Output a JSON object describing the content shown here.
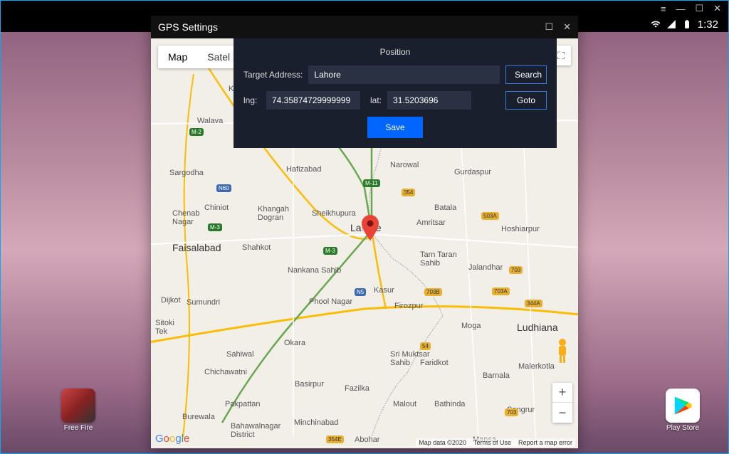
{
  "titlebar": {
    "menu": "≡",
    "min": "—",
    "max": "☐",
    "close": "✕"
  },
  "statusbar": {
    "time": "1:32"
  },
  "gps": {
    "title": "GPS Settings",
    "tabs": {
      "map": "Map",
      "satellite": "Satel"
    },
    "panel": {
      "heading": "Position",
      "target_label": "Target Address:",
      "target_value": "Lahore",
      "search": "Search",
      "lng_label": "lng:",
      "lng_value": "74.35874729999999",
      "lat_label": "lat:",
      "lat_value": "31.5203696",
      "goto": "Goto",
      "save": "Save"
    },
    "footer": {
      "data": "Map data ©2020",
      "terms": "Terms of Use",
      "report": "Report a map error"
    }
  },
  "desktop": {
    "freefire": "Free Fire",
    "playstore": "Play Store"
  },
  "cities": {
    "lahore": "Lahore",
    "faisalabad": "Faisalabad",
    "ludhiana": "Ludhiana",
    "amritsar": "Amritsar",
    "jalandhar": "Jalandhar",
    "kasur": "Kasur",
    "okara": "Okara",
    "sahiwal": "Sahiwal",
    "sargodha": "Sargodha",
    "hafizabad": "Hafizabad",
    "sheikhupura": "Sheikhupura",
    "narowal": "Narowal",
    "gurdaspur": "Gurdaspur",
    "batala": "Batala",
    "tarntaran": "Tarn Taran\nSahib",
    "hoshiarpur": "Hoshiarpur",
    "firozpur": "Firozpur",
    "moga": "Moga",
    "faridkot": "Faridkot",
    "muktsar": "Sri Muktsar\nSahib",
    "bathinda": "Bathinda",
    "mansa": "Mansa",
    "sangrur": "Sangrur",
    "barnala": "Barnala",
    "malerkotla": "Malerkotla",
    "fazilka": "Fazilka",
    "abohar": "Abohar",
    "malout": "Malout",
    "nankana": "Nankana Sahib",
    "chiniot": "Chiniot",
    "chenab": "Chenab\nNagar",
    "khangah": "Khangah\nDogran",
    "phool": "Phool Nagar",
    "sumundri": "Sumundri",
    "dijkot": "Dijkot",
    "chichawatni": "Chichawatni",
    "burewala": "Burewala",
    "pakpattan": "Pakpattan",
    "bahawalnagar": "Bahawalnagar\nDistrict",
    "minchinabad": "Minchinabad",
    "sitoki": "Sitoki\nTek",
    "khewra": "Khewra",
    "walava": "Walava"
  },
  "roads": {
    "m2": "M-2",
    "m3": "M-3",
    "m11": "M-11",
    "n5": "N5",
    "n60": "N60",
    "r354": "354",
    "r503a": "503A",
    "r703": "703",
    "r703a": "703A",
    "r703b": "703B",
    "r344a": "344A",
    "r54": "54",
    "r354e": "354E"
  }
}
